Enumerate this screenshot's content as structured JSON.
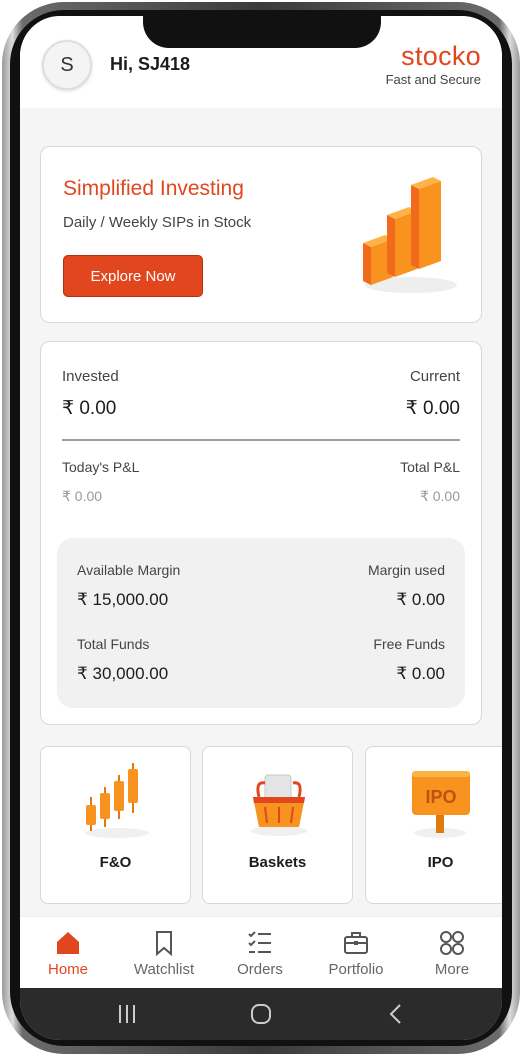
{
  "header": {
    "avatar_initial": "S",
    "greeting": "Hi, SJ418",
    "brand_name": "stocko",
    "brand_tagline": "Fast and Secure"
  },
  "promo": {
    "title": "Simplified Investing",
    "subtitle": "Daily / Weekly SIPs in Stock",
    "button_label": "Explore Now",
    "art_icon": "bar-chart-3d-icon"
  },
  "summary": {
    "invested_label": "Invested",
    "invested_value": "₹ 0.00",
    "current_label": "Current",
    "current_value": "₹ 0.00",
    "todays_pl_label": "Today's P&L",
    "todays_pl_value": "₹ 0.00",
    "total_pl_label": "Total P&L",
    "total_pl_value": "₹ 0.00",
    "available_margin_label": "Available Margin",
    "available_margin_value": "₹ 15,000.00",
    "margin_used_label": "Margin used",
    "margin_used_value": "₹ 0.00",
    "total_funds_label": "Total Funds",
    "total_funds_value": "₹ 30,000.00",
    "free_funds_label": "Free Funds",
    "free_funds_value": "₹ 0.00"
  },
  "tiles": [
    {
      "label": "F&O",
      "icon": "candlestick-chart-icon"
    },
    {
      "label": "Baskets",
      "icon": "basket-icon"
    },
    {
      "label": "IPO",
      "icon": "ipo-sign-icon"
    }
  ],
  "nav": [
    {
      "label": "Home",
      "icon": "home-icon",
      "active": true
    },
    {
      "label": "Watchlist",
      "icon": "bookmark-icon",
      "active": false
    },
    {
      "label": "Orders",
      "icon": "checklist-icon",
      "active": false
    },
    {
      "label": "Portfolio",
      "icon": "briefcase-icon",
      "active": false
    },
    {
      "label": "More",
      "icon": "grid-circles-icon",
      "active": false
    }
  ],
  "colors": {
    "accent": "#e2461e",
    "orange": "#f7931e",
    "background": "#f5f5f6"
  }
}
